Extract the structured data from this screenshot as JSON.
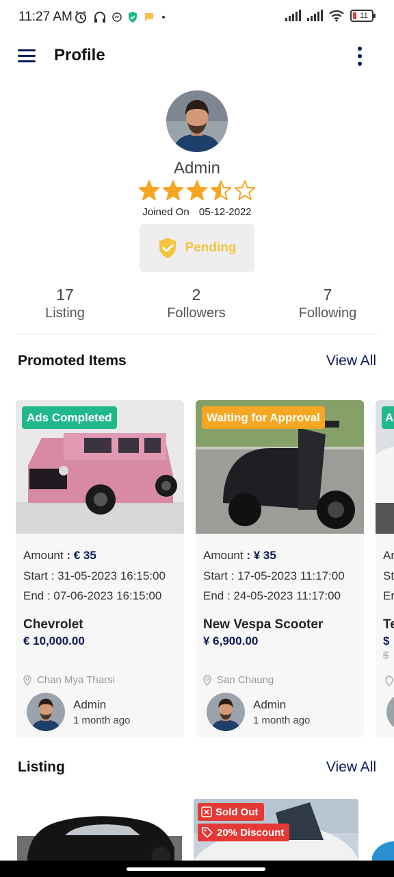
{
  "status_bar": {
    "time": "11:27 AM",
    "battery": "11"
  },
  "app_bar": {
    "title": "Profile"
  },
  "profile": {
    "name": "Admin",
    "rating": 3.5,
    "joined_label": "Joined On",
    "joined_date": "05-12-2022",
    "status": "Pending"
  },
  "stats": [
    {
      "value": "17",
      "label": "Listing"
    },
    {
      "value": "2",
      "label": "Followers"
    },
    {
      "value": "7",
      "label": "Following"
    }
  ],
  "promoted": {
    "title": "Promoted Items",
    "view_all": "View All",
    "items": [
      {
        "badge": "Ads Completed",
        "amount_label": "Amount",
        "amount": "€ 35",
        "start": "Start : 31-05-2023 16:15:00",
        "end": "End : 07-06-2023 16:15:00",
        "name": "Chevrolet",
        "price": "€ 10,000.00",
        "location": "Chan Mya Tharsi",
        "user": "Admin",
        "time": "1 month ago"
      },
      {
        "badge": "Waiting for Approval",
        "amount_label": "Amount",
        "amount": "¥ 35",
        "start": "Start : 17-05-2023 11:17:00",
        "end": "End : 24-05-2023 11:17:00",
        "name": "New Vespa Scooter",
        "price": "¥ 6,900.00",
        "location": "San Chaung",
        "user": "Admin",
        "time": "1 month ago"
      },
      {
        "badge": "A",
        "amount_label": "Ar",
        "start": "St",
        "end": "Er",
        "name": "Te",
        "price": "$",
        "old_price": "$"
      }
    ]
  },
  "listing": {
    "title": "Listing",
    "view_all": "View All",
    "tags": {
      "sold_out": "Sold Out",
      "discount": "20% Discount"
    }
  },
  "colors": {
    "brand": "#0b1a57",
    "badge_green": "#21b98b",
    "badge_orange": "#f5a623",
    "pending": "#f5c43e",
    "star": "#f5a623",
    "tag_red": "#e53935"
  }
}
